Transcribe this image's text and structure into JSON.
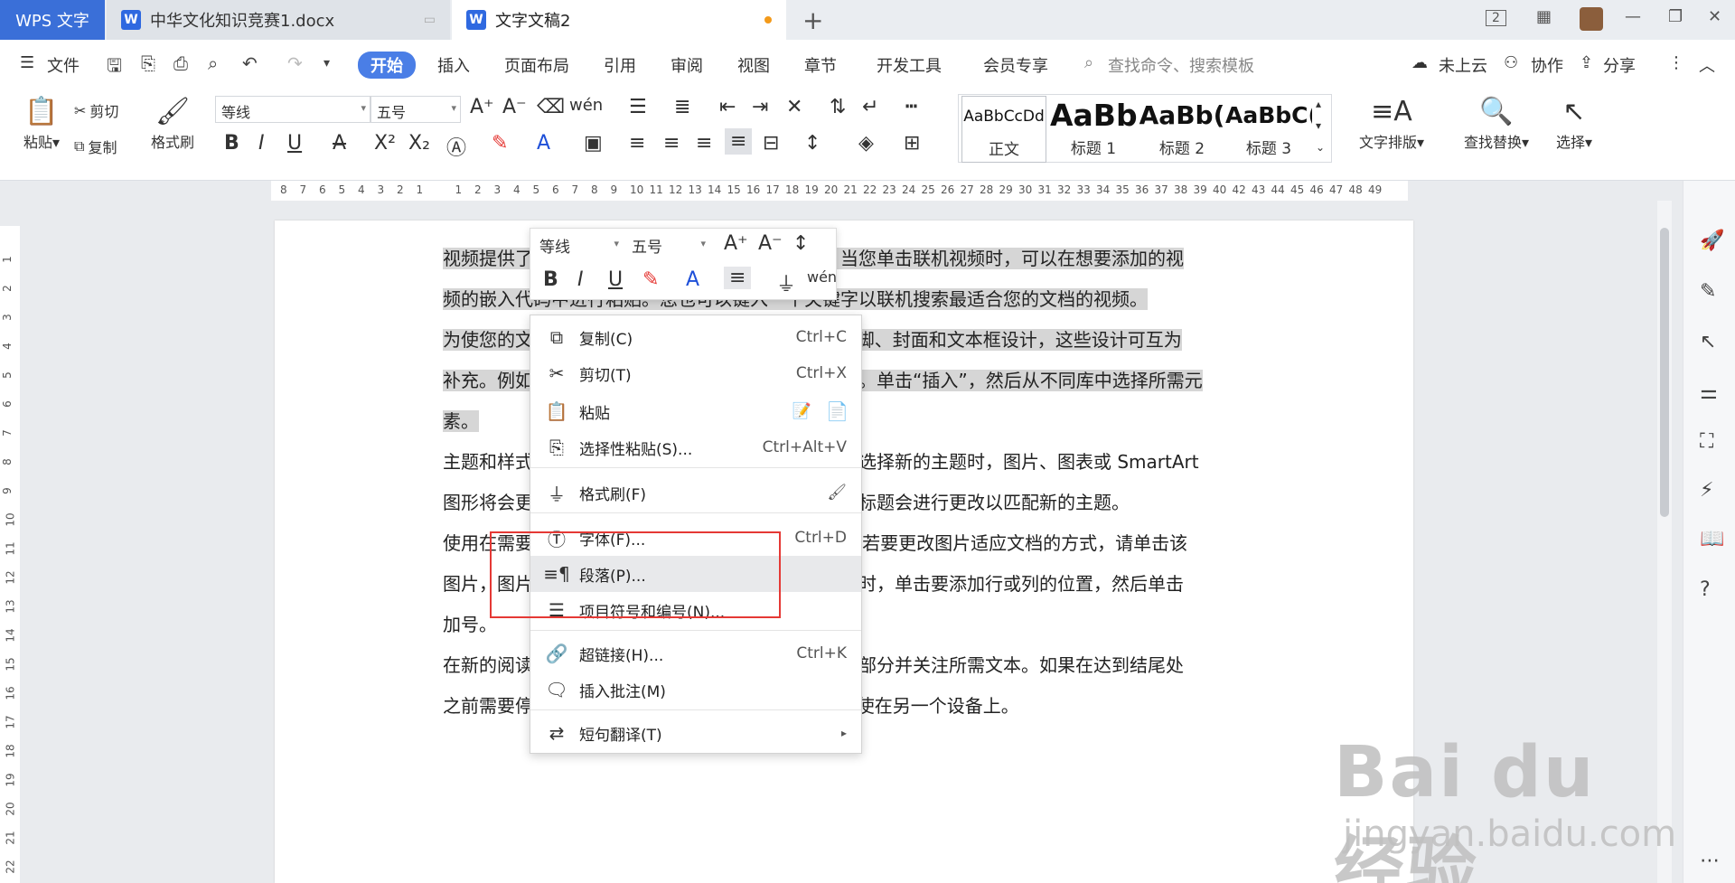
{
  "titlebar": {
    "app_tab": "WPS 文字",
    "doc_tab_1": "中华文化知识竞赛1.docx",
    "doc_tab_2": "文字文稿2",
    "new_tab": "+",
    "page_count": "2"
  },
  "menubar": {
    "file": "文件",
    "items": [
      "开始",
      "插入",
      "页面布局",
      "引用",
      "审阅",
      "视图",
      "章节",
      "开发工具",
      "会员专享"
    ],
    "search_placeholder": "查找命令、搜索模板",
    "cloud": "未上云",
    "collab": "协作",
    "share": "分享"
  },
  "ribbon": {
    "paste": "粘贴",
    "cut": "剪切",
    "copy": "复制",
    "format_painter": "格式刷",
    "font_name": "等线",
    "font_size": "五号",
    "styles": [
      {
        "sample": "AaBbCcDd",
        "name": "正文"
      },
      {
        "sample": "AaBb",
        "name": "标题 1"
      },
      {
        "sample": "AaBb(",
        "name": "标题 2"
      },
      {
        "sample": "AaBbC(",
        "name": "标题 3"
      }
    ],
    "text_layout": "文字排版",
    "find_replace": "查找替换",
    "select": "选择"
  },
  "ruler": {
    "left_numbers": [
      "8",
      "7",
      "6",
      "5",
      "4",
      "3",
      "2",
      "1"
    ],
    "right_numbers": [
      "1",
      "2",
      "3",
      "4",
      "5",
      "6",
      "7",
      "8",
      "9",
      "10",
      "11",
      "12",
      "13",
      "14",
      "15",
      "16",
      "17",
      "18",
      "19",
      "20",
      "21",
      "22",
      "23",
      "24",
      "25",
      "26",
      "27",
      "28",
      "29",
      "30",
      "31",
      "32",
      "33",
      "34",
      "35",
      "36",
      "37",
      "38",
      "39",
      "40",
      "42",
      "43",
      "44",
      "45",
      "46",
      "47",
      "48",
      "49"
    ],
    "vertical_numbers": [
      "1",
      "2",
      "3",
      "4",
      "5",
      "6",
      "7",
      "8",
      "9",
      "10",
      "11",
      "12",
      "13",
      "14",
      "15",
      "16",
      "17",
      "18",
      "19",
      "20",
      "21",
      "22"
    ]
  },
  "document": {
    "line1": "视频提供了功能强大的方法帮助您证明您的观点。当您单击联机视频时，可以在想要添加的视",
    "line2": "频的嵌入代码中进行粘贴。您也可以键入一个关键字以联机搜索最适合您的文档的视频。",
    "line3": "为使您的文档具有专业外观，Word 提供了页眉、页脚、封面和文本框设计，这些设计可互为",
    "line4": "补充。例如，您可以添加匹配的封面、页眉和提要栏。单击“插入”，然后从不同库中选择所需元",
    "line5": "素。",
    "line6": "主题和样式也有助于文档保持协调。当您单击设计并选择新的主题时，图片、图表或 SmartArt",
    "line7": "图形将会更改以匹配新的主题。当应用样式时，您的标题会进行更改以匹配新的主题。",
    "line8": "使用在需要位置出现的新按钮在 Word 中节省时间。若要更改图片适应文档的方式，请单击该",
    "line9": "图片，图片旁边将会显示布局选项按钮。当处理表格时，单击要添加行或列的位置，然后单击",
    "line10": "加号。",
    "line11": "在新的阅读视图中阅读更加容易。可以折叠文档某些部分并关注所需文本。如果在达到结尾处",
    "line12": "之前需要停止读取，Word 会记住您的停止位置 - 即使在另一个设备上。"
  },
  "mini_toolbar": {
    "font_name": "等线",
    "font_size": "五号"
  },
  "context_menu": {
    "items": [
      {
        "icon": "copy-icon",
        "label": "复制(C)",
        "shortcut": "Ctrl+C"
      },
      {
        "icon": "scissors-icon",
        "label": "剪切(T)",
        "shortcut": "Ctrl+X"
      },
      {
        "icon": "paste-icon",
        "label": "粘贴",
        "shortcut": ""
      },
      {
        "icon": "paste-special-icon",
        "label": "选择性粘贴(S)...",
        "shortcut": "Ctrl+Alt+V"
      },
      {
        "icon": "brush-icon",
        "label": "格式刷(F)",
        "shortcut": ""
      },
      {
        "icon": "font-icon",
        "label": "字体(F)...",
        "shortcut": "Ctrl+D"
      },
      {
        "icon": "paragraph-icon",
        "label": "段落(P)...",
        "shortcut": ""
      },
      {
        "icon": "list-icon",
        "label": "项目符号和编号(N)...",
        "shortcut": ""
      },
      {
        "icon": "link-icon",
        "label": "超链接(H)...",
        "shortcut": "Ctrl+K"
      },
      {
        "icon": "comment-icon",
        "label": "插入批注(M)",
        "shortcut": ""
      },
      {
        "icon": "translate-icon",
        "label": "短句翻译(T)",
        "shortcut": ""
      }
    ]
  },
  "watermark": {
    "logo": "Bai du 经验",
    "url": "jingyan.baidu.com"
  },
  "colors": {
    "accent": "#4a7ee6",
    "highlight_red": "#e53935",
    "selection": "#d6d6d6"
  }
}
